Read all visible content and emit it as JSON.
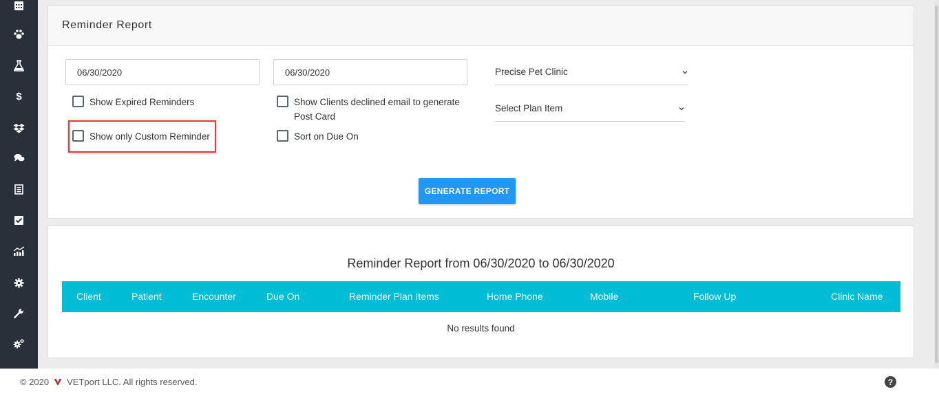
{
  "sidebar": {
    "items": [
      {
        "icon": "calendar-icon"
      },
      {
        "icon": "paw-icon"
      },
      {
        "icon": "flask-icon"
      },
      {
        "icon": "dollar-icon"
      },
      {
        "icon": "dropbox-icon"
      },
      {
        "icon": "chat-icon"
      },
      {
        "icon": "receipt-icon"
      },
      {
        "icon": "checkbox-icon"
      },
      {
        "icon": "chart-icon"
      },
      {
        "icon": "gear-icon"
      },
      {
        "icon": "wrench-icon"
      },
      {
        "icon": "gears-icon"
      }
    ],
    "dollar_glyph": "$"
  },
  "filters": {
    "title": "Reminder Report",
    "from_date": "06/30/2020",
    "to_date": "06/30/2020",
    "show_expired_label": "Show Expired Reminders",
    "show_custom_label": "Show only Custom Reminder",
    "show_declined_label": "Show Clients declined email to generate Post Card",
    "sort_due_label": "Sort on Due On",
    "clinic_select": "Precise Pet Clinic",
    "plan_item_select": "Select Plan Item",
    "generate_button": "GENERATE REPORT"
  },
  "report": {
    "title": "Reminder Report from 06/30/2020 to 06/30/2020",
    "columns": [
      "Client",
      "Patient",
      "Encounter",
      "Due On",
      "Reminder Plan Items",
      "Home Phone",
      "Mobile",
      "Follow Up",
      "Clinic Name"
    ],
    "empty_message": "No results found"
  },
  "footer": {
    "copyright": "© 2020",
    "company": "VETport LLC. All rights reserved.",
    "help": "?"
  },
  "colors": {
    "sidebar": "#28303a",
    "table_header": "#00bcd4",
    "button": "#2196f3",
    "highlight": "#e53935"
  }
}
